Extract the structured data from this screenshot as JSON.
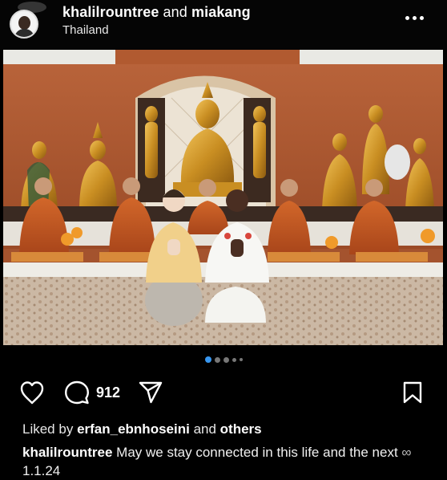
{
  "post": {
    "author": "khalilrountree",
    "connector": "and",
    "collaborator": "miakang",
    "location": "Thailand"
  },
  "carousel": {
    "slide_count": 5,
    "active_index": 0
  },
  "actions": {
    "comment_count": "912"
  },
  "likes": {
    "prefix": "Liked by",
    "user": "erfan_ebnhoseini",
    "connector": "and",
    "others": "others"
  },
  "caption": {
    "author": "khalilrountree",
    "text": "May we stay connected in this life and the next",
    "emoji": "∞",
    "date": "1.1.24"
  },
  "icons": [
    "more-options-icon",
    "heart-icon",
    "comment-icon",
    "share-icon",
    "bookmark-icon"
  ],
  "colors": {
    "background": "#000000",
    "carousel_active": "#3897f0"
  }
}
